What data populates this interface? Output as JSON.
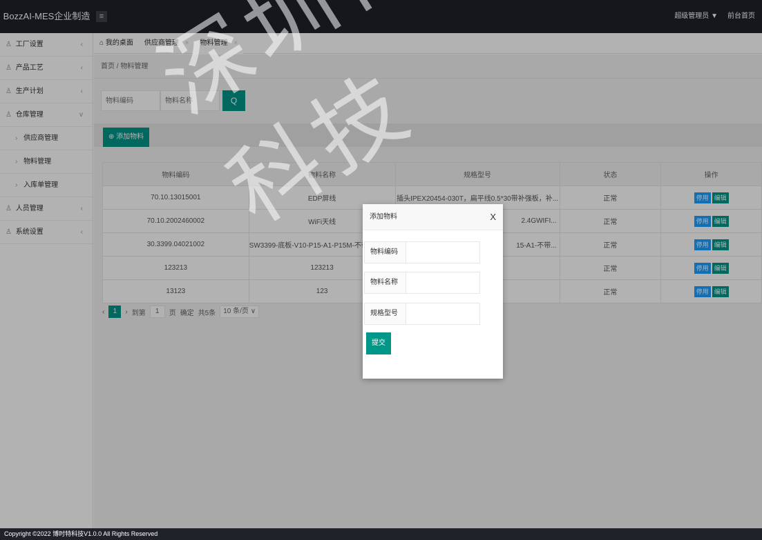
{
  "app": {
    "title": "BozzAI-MES企业制造",
    "menu_toggle_icon": "hamburger-icon",
    "user_label": "超级管理员 ▼",
    "home_link": "前台首页"
  },
  "sidebar": {
    "items": [
      {
        "label": "工厂设置",
        "chevron": "‹"
      },
      {
        "label": "产品工艺",
        "chevron": "‹"
      },
      {
        "label": "生产计划",
        "chevron": "‹"
      },
      {
        "label": "仓库管理",
        "chevron": "v"
      },
      {
        "label": "人员管理",
        "chevron": "‹"
      },
      {
        "label": "系统设置",
        "chevron": "‹"
      }
    ],
    "sub_items": [
      {
        "label": "供应商管理",
        "arrow": "›"
      },
      {
        "label": "物料管理",
        "arrow": "›"
      },
      {
        "label": "入库单管理",
        "arrow": "›"
      }
    ]
  },
  "tabs": [
    {
      "label": "我的桌面",
      "icon": "home-icon"
    },
    {
      "label": "供应商管理",
      "close": "×"
    },
    {
      "label": "物料管理",
      "close": "×"
    }
  ],
  "breadcrumb": "首页 / 物料管理",
  "search": {
    "code_placeholder": "物料编码",
    "name_placeholder": "物料名称",
    "button_icon": "Q"
  },
  "toolbar": {
    "add_label": "添加物料"
  },
  "table": {
    "headers": [
      "物料编码",
      "物料名称",
      "规格型号",
      "状态",
      "操作"
    ],
    "rows": [
      {
        "code": "70.10.13015001",
        "name": "EDP屏线",
        "spec": "插头IPEX20454-030T，扁平线0.5*30带补强板，补...",
        "status": "正常"
      },
      {
        "code": "70.10.2002460002",
        "name": "WiFi天线",
        "spec": "2.4GWIFI...",
        "status": "正常"
      },
      {
        "code": "30.3399.04021002",
        "name": "SW3399-底板-V10-P15-A1-P15M-不带4G",
        "spec": "15-A1-不带...",
        "status": "正常"
      },
      {
        "code": "123213",
        "name": "123213",
        "spec": "",
        "status": "正常"
      },
      {
        "code": "13123",
        "name": "123",
        "spec": "",
        "status": "正常"
      }
    ],
    "disable_label": "停用",
    "edit_label": "编辑"
  },
  "pager": {
    "prev": "‹",
    "current": "1",
    "next": "›",
    "goto_label": "到第",
    "goto_value": "1",
    "page_unit": "页",
    "confirm": "确定",
    "total": "共5条",
    "page_size": "10 条/页 ∨"
  },
  "watermark": {
    "line1": "深圳博时特",
    "line2": "科技"
  },
  "modal": {
    "title": "添加物料",
    "close": "X",
    "fields": [
      {
        "label": "物料编码",
        "value": ""
      },
      {
        "label": "物料名称",
        "value": ""
      },
      {
        "label": "规格型号",
        "value": ""
      }
    ],
    "submit": "提交"
  },
  "footer": {
    "text": "Copyright ©2022 博时特科技V1.0.0 All Rights Reserved"
  }
}
